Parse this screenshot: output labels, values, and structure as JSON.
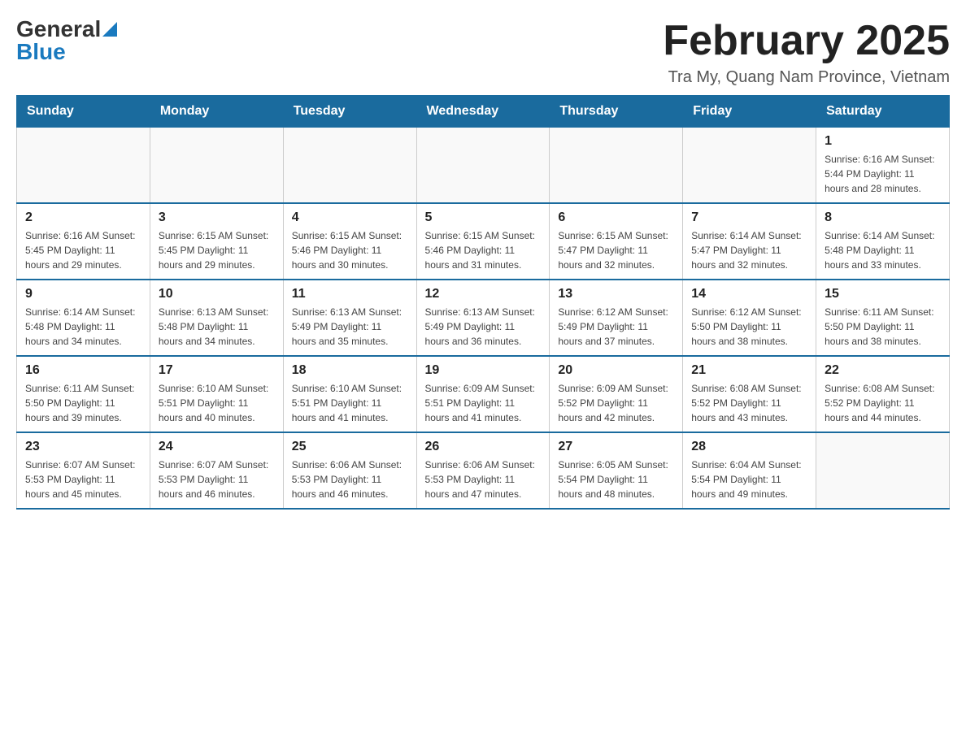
{
  "header": {
    "logo_general": "General",
    "logo_blue": "Blue",
    "title": "February 2025",
    "subtitle": "Tra My, Quang Nam Province, Vietnam"
  },
  "calendar": {
    "weekdays": [
      "Sunday",
      "Monday",
      "Tuesday",
      "Wednesday",
      "Thursday",
      "Friday",
      "Saturday"
    ],
    "weeks": [
      [
        {
          "day": "",
          "info": ""
        },
        {
          "day": "",
          "info": ""
        },
        {
          "day": "",
          "info": ""
        },
        {
          "day": "",
          "info": ""
        },
        {
          "day": "",
          "info": ""
        },
        {
          "day": "",
          "info": ""
        },
        {
          "day": "1",
          "info": "Sunrise: 6:16 AM\nSunset: 5:44 PM\nDaylight: 11 hours and 28 minutes."
        }
      ],
      [
        {
          "day": "2",
          "info": "Sunrise: 6:16 AM\nSunset: 5:45 PM\nDaylight: 11 hours and 29 minutes."
        },
        {
          "day": "3",
          "info": "Sunrise: 6:15 AM\nSunset: 5:45 PM\nDaylight: 11 hours and 29 minutes."
        },
        {
          "day": "4",
          "info": "Sunrise: 6:15 AM\nSunset: 5:46 PM\nDaylight: 11 hours and 30 minutes."
        },
        {
          "day": "5",
          "info": "Sunrise: 6:15 AM\nSunset: 5:46 PM\nDaylight: 11 hours and 31 minutes."
        },
        {
          "day": "6",
          "info": "Sunrise: 6:15 AM\nSunset: 5:47 PM\nDaylight: 11 hours and 32 minutes."
        },
        {
          "day": "7",
          "info": "Sunrise: 6:14 AM\nSunset: 5:47 PM\nDaylight: 11 hours and 32 minutes."
        },
        {
          "day": "8",
          "info": "Sunrise: 6:14 AM\nSunset: 5:48 PM\nDaylight: 11 hours and 33 minutes."
        }
      ],
      [
        {
          "day": "9",
          "info": "Sunrise: 6:14 AM\nSunset: 5:48 PM\nDaylight: 11 hours and 34 minutes."
        },
        {
          "day": "10",
          "info": "Sunrise: 6:13 AM\nSunset: 5:48 PM\nDaylight: 11 hours and 34 minutes."
        },
        {
          "day": "11",
          "info": "Sunrise: 6:13 AM\nSunset: 5:49 PM\nDaylight: 11 hours and 35 minutes."
        },
        {
          "day": "12",
          "info": "Sunrise: 6:13 AM\nSunset: 5:49 PM\nDaylight: 11 hours and 36 minutes."
        },
        {
          "day": "13",
          "info": "Sunrise: 6:12 AM\nSunset: 5:49 PM\nDaylight: 11 hours and 37 minutes."
        },
        {
          "day": "14",
          "info": "Sunrise: 6:12 AM\nSunset: 5:50 PM\nDaylight: 11 hours and 38 minutes."
        },
        {
          "day": "15",
          "info": "Sunrise: 6:11 AM\nSunset: 5:50 PM\nDaylight: 11 hours and 38 minutes."
        }
      ],
      [
        {
          "day": "16",
          "info": "Sunrise: 6:11 AM\nSunset: 5:50 PM\nDaylight: 11 hours and 39 minutes."
        },
        {
          "day": "17",
          "info": "Sunrise: 6:10 AM\nSunset: 5:51 PM\nDaylight: 11 hours and 40 minutes."
        },
        {
          "day": "18",
          "info": "Sunrise: 6:10 AM\nSunset: 5:51 PM\nDaylight: 11 hours and 41 minutes."
        },
        {
          "day": "19",
          "info": "Sunrise: 6:09 AM\nSunset: 5:51 PM\nDaylight: 11 hours and 41 minutes."
        },
        {
          "day": "20",
          "info": "Sunrise: 6:09 AM\nSunset: 5:52 PM\nDaylight: 11 hours and 42 minutes."
        },
        {
          "day": "21",
          "info": "Sunrise: 6:08 AM\nSunset: 5:52 PM\nDaylight: 11 hours and 43 minutes."
        },
        {
          "day": "22",
          "info": "Sunrise: 6:08 AM\nSunset: 5:52 PM\nDaylight: 11 hours and 44 minutes."
        }
      ],
      [
        {
          "day": "23",
          "info": "Sunrise: 6:07 AM\nSunset: 5:53 PM\nDaylight: 11 hours and 45 minutes."
        },
        {
          "day": "24",
          "info": "Sunrise: 6:07 AM\nSunset: 5:53 PM\nDaylight: 11 hours and 46 minutes."
        },
        {
          "day": "25",
          "info": "Sunrise: 6:06 AM\nSunset: 5:53 PM\nDaylight: 11 hours and 46 minutes."
        },
        {
          "day": "26",
          "info": "Sunrise: 6:06 AM\nSunset: 5:53 PM\nDaylight: 11 hours and 47 minutes."
        },
        {
          "day": "27",
          "info": "Sunrise: 6:05 AM\nSunset: 5:54 PM\nDaylight: 11 hours and 48 minutes."
        },
        {
          "day": "28",
          "info": "Sunrise: 6:04 AM\nSunset: 5:54 PM\nDaylight: 11 hours and 49 minutes."
        },
        {
          "day": "",
          "info": ""
        }
      ]
    ]
  }
}
